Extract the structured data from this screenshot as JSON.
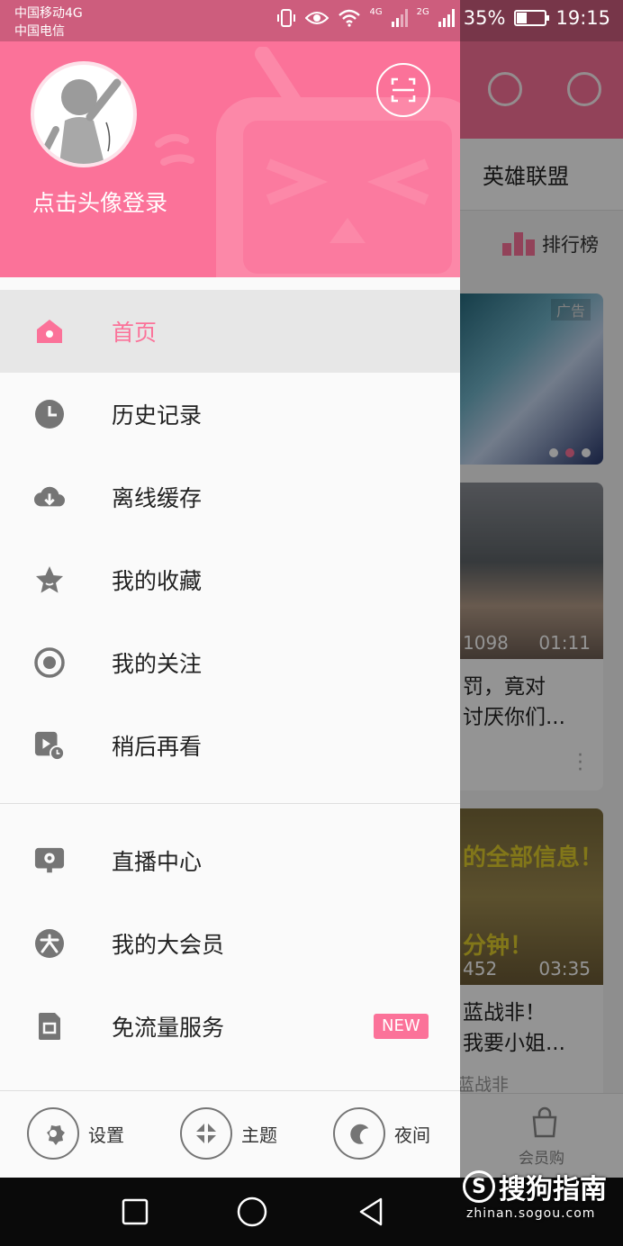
{
  "status_bar": {
    "carrier_1": "中国移动4G",
    "carrier_2": "中国电信",
    "network_1": "4G",
    "network_2": "2G",
    "battery_percent": "35%",
    "battery_level": 0.35,
    "time": "19:15"
  },
  "drawer": {
    "login_prompt": "点击头像登录",
    "menu_group_1": [
      {
        "label": "首页",
        "icon": "home-icon",
        "active": true
      },
      {
        "label": "历史记录",
        "icon": "clock-icon"
      },
      {
        "label": "离线缓存",
        "icon": "cloud-download-icon"
      },
      {
        "label": "我的收藏",
        "icon": "star-icon"
      },
      {
        "label": "我的关注",
        "icon": "follow-icon"
      },
      {
        "label": "稍后再看",
        "icon": "watch-later-icon"
      }
    ],
    "menu_group_2": [
      {
        "label": "直播中心",
        "icon": "live-tv-icon"
      },
      {
        "label": "我的大会员",
        "icon": "vip-icon"
      },
      {
        "label": "免流量服务",
        "icon": "sim-card-icon",
        "badge": "NEW"
      }
    ],
    "bottom_actions": [
      {
        "label": "设置",
        "icon": "settings-icon"
      },
      {
        "label": "主题",
        "icon": "theme-icon"
      },
      {
        "label": "夜间",
        "icon": "moon-icon"
      }
    ]
  },
  "background": {
    "tab_label": "英雄联盟",
    "ranking_label": "排行榜",
    "banner_ad": "广告",
    "card_1": {
      "views": "1098",
      "duration": "01:11",
      "title_line_1": "罚，竟对",
      "title_line_2": "讨厌你们..."
    },
    "card_2": {
      "overlay_1": "的全部信息！",
      "overlay_2": "分钟！",
      "views": "452",
      "duration": "03:35",
      "title_line_1": "蓝战非！",
      "title_line_2": "我要小姐...",
      "uploader": "蓝战非"
    },
    "vip_shop_label": "会员购"
  },
  "watermark": {
    "brand": "搜狗指南",
    "url": "zhinan.sogou.com"
  },
  "colors": {
    "accent": "#fb7299",
    "drawer_bg": "#fafafa",
    "active_item_bg": "#e7e7e7",
    "icon_gray": "#757575"
  }
}
